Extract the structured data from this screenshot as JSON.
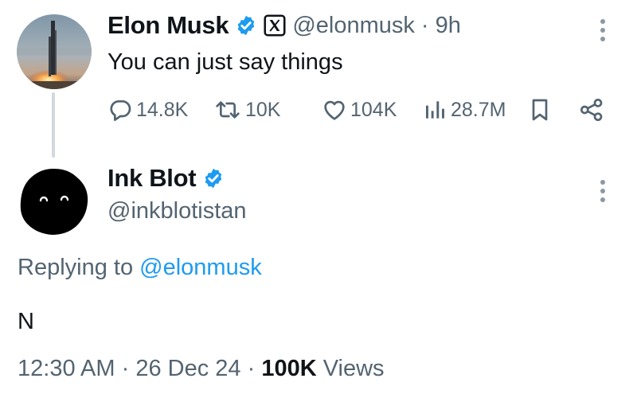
{
  "tweet": {
    "author_name": "Elon Musk",
    "author_handle": "@elonmusk",
    "separator": "·",
    "time_ago": "9h",
    "text": "You can just say things",
    "stats": {
      "replies": "14.8K",
      "reposts": "10K",
      "likes": "104K",
      "views": "28.7M"
    }
  },
  "reply": {
    "author_name": "Ink Blot",
    "author_handle": "@inkblotistan",
    "replying_prefix": "Replying to ",
    "replying_handle": "@elonmusk",
    "text": "N",
    "time": "12:30 AM",
    "separator": "·",
    "date": "26 Dec 24",
    "views_count": "100K",
    "views_label": "Views"
  },
  "colors": {
    "accent": "#1d9bf0",
    "secondary_text": "#536471",
    "primary_text": "#0f1419",
    "thread_line": "#cfd9de"
  },
  "icons": [
    "verified-badge-icon",
    "x-logo-badge-icon",
    "reply-icon",
    "repost-icon",
    "like-icon",
    "views-icon",
    "bookmark-icon",
    "share-icon",
    "more-options-icon"
  ]
}
